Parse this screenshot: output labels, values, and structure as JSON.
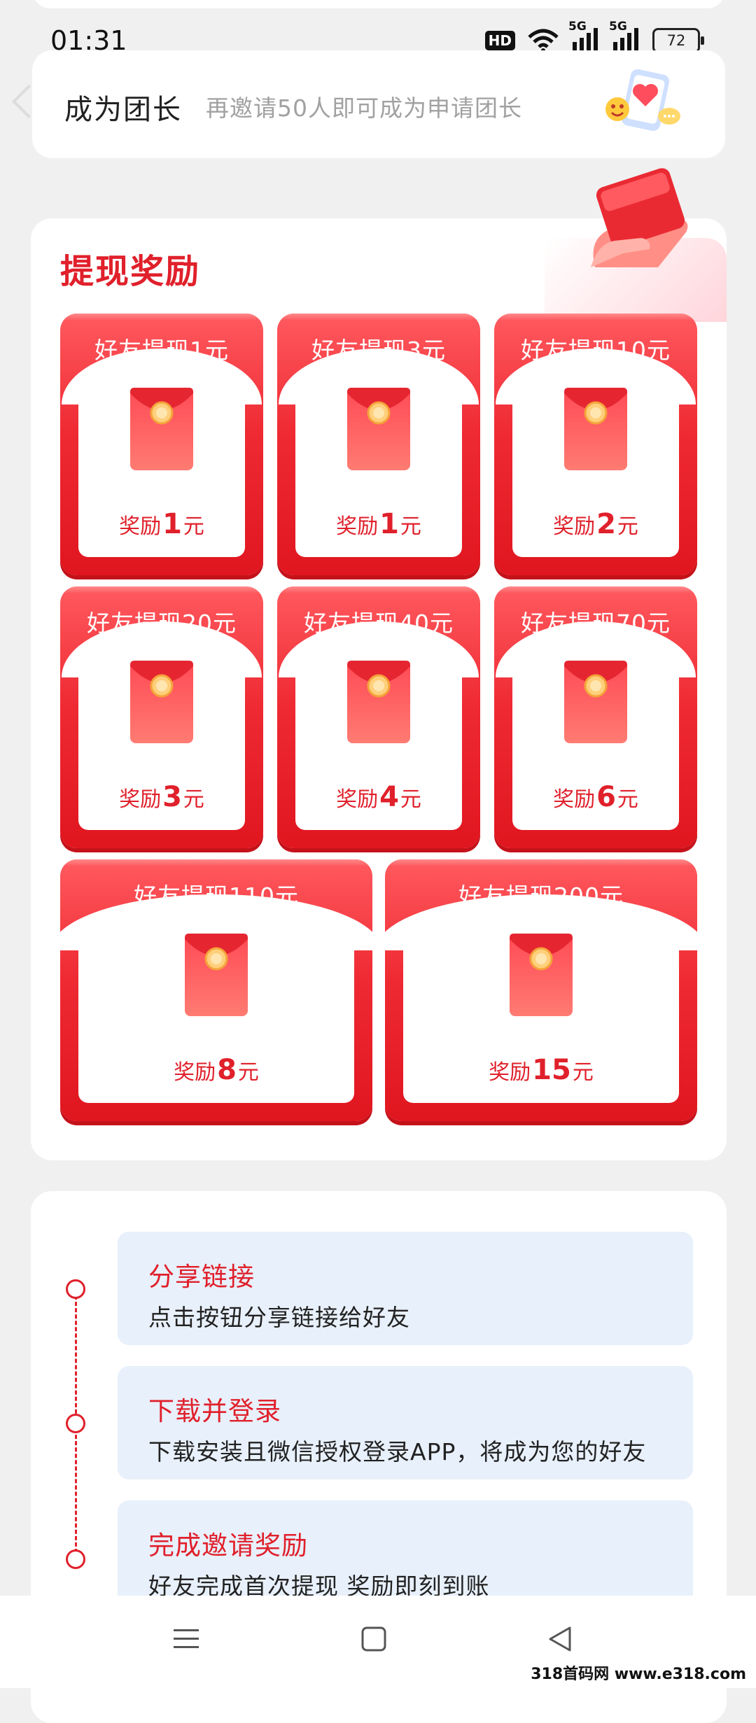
{
  "status_bar": {
    "time": "01:31",
    "hd_label": "HD",
    "network_1": "5G",
    "network_2": "5G",
    "battery": "72"
  },
  "leader": {
    "title": "成为团长",
    "description": "再邀请50人即可成为申请团长"
  },
  "rewards": {
    "title": "提现奖励",
    "reward_prefix": "奖励",
    "currency_suffix": "元",
    "cards": [
      {
        "title": "好友提现1元",
        "reward": "1"
      },
      {
        "title": "好友提现3元",
        "reward": "1"
      },
      {
        "title": "好友提现10元",
        "reward": "2"
      },
      {
        "title": "好友提现20元",
        "reward": "3"
      },
      {
        "title": "好友提现40元",
        "reward": "4"
      },
      {
        "title": "好友提现70元",
        "reward": "6"
      },
      {
        "title": "好友提现110元",
        "reward": "8"
      },
      {
        "title": "好友提现200元",
        "reward": "15"
      }
    ]
  },
  "steps": [
    {
      "title": "分享链接",
      "description": "点击按钮分享链接给好友"
    },
    {
      "title": "下载并登录",
      "description": "下载安装且微信授权登录APP，将成为您的好友"
    },
    {
      "title": "完成邀请奖励",
      "description": "好友完成首次提现 奖励即刻到账"
    }
  ],
  "nav": {
    "icons": [
      "menu-icon",
      "home-square-icon",
      "back-triangle-icon"
    ]
  },
  "watermark": "318首码网 www.e318.com",
  "colors": {
    "accent_red": "#e0202b",
    "step_background": "#e8f0fb",
    "page_background": "#f0f0f0"
  }
}
